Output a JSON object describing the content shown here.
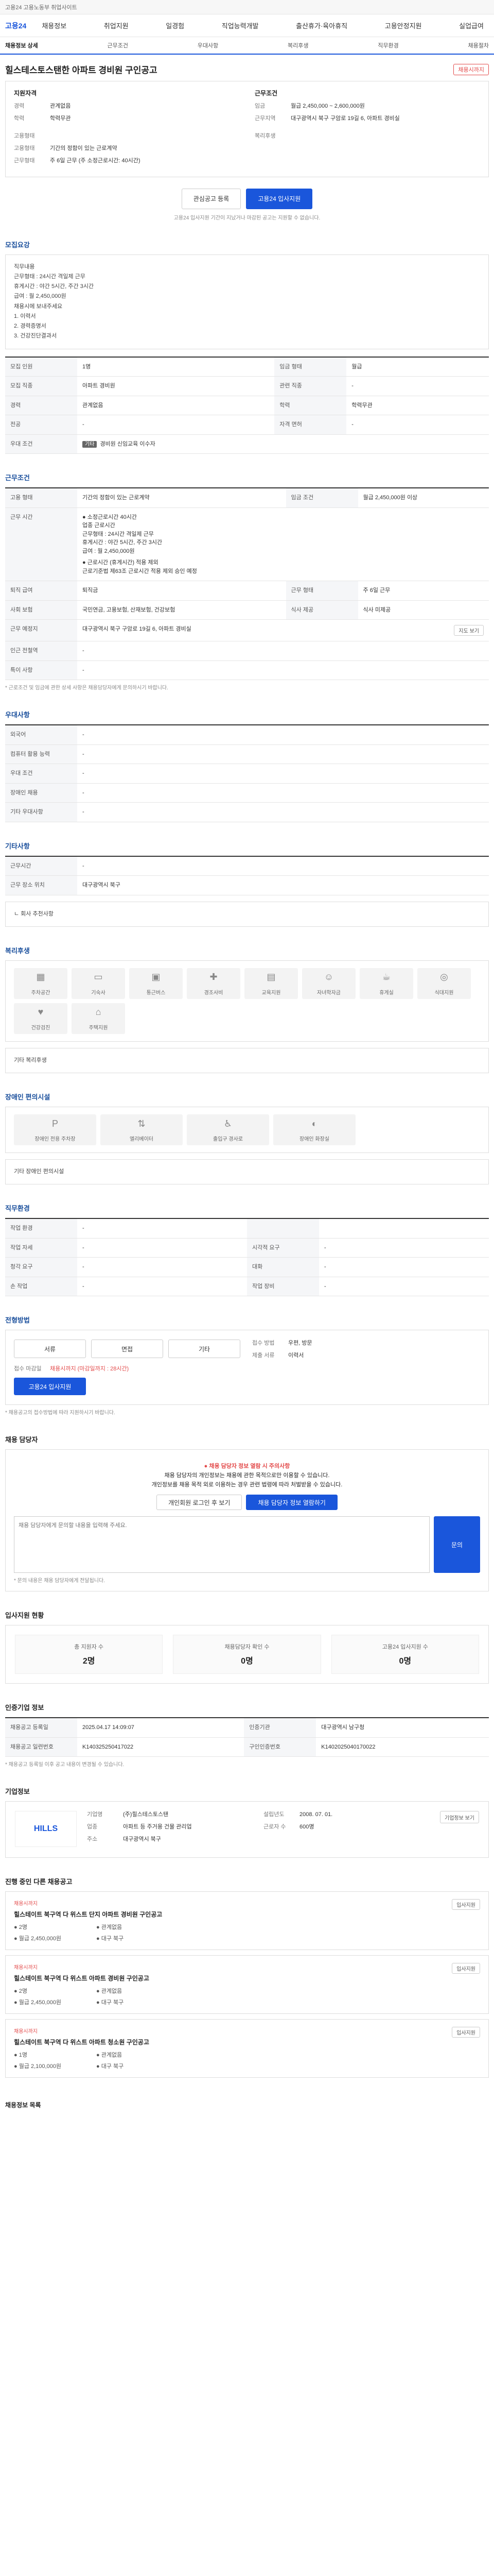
{
  "topbar": {
    "notice": "고용24 고용노동부 취업사이트"
  },
  "gnb": {
    "logo": "고용24",
    "items": [
      "채용정보",
      "취업지원",
      "일경험",
      "직업능력개발",
      "출산휴가·육아휴직",
      "고용안정지원",
      "실업급여"
    ]
  },
  "subnav": [
    "채용정보 상세",
    "근무조건",
    "우대사항",
    "복리후생",
    "직무환경",
    "채용절차"
  ],
  "job": {
    "title": "힐스테스토스탠한 아파트 경비원 구인공고",
    "status": "채용시까지"
  },
  "summary": {
    "career_heading": "지원자격",
    "career_label": "경력",
    "career": "관계없음",
    "edu_label": "학력",
    "edu": "학력무관",
    "cond_heading": "고용형태",
    "employ_label": "고용형태",
    "employ": "기간의 정함이 있는 근로계약",
    "worktime_label": "근무형태",
    "worktime": "주 6일 근무 (주 소정근로시간: 40시간)",
    "terms_heading": "근무조건",
    "salary_label": "임금",
    "salary": "월급 2,450,000 ~ 2,600,000원",
    "location_label": "근무지역",
    "location": "대구광역시 북구 구암로 19길 6, 아파트 경비실",
    "benefit_label": "복리후생"
  },
  "actions": {
    "scrap": "관심공고 등록",
    "apply": "고용24 입사지원",
    "note": "고용24 입사지원 기간이 지났거나 마감된 공고는 지원할 수 없습니다."
  },
  "recruit": {
    "title": "모집요강",
    "desc": [
      "직무내용",
      "근무형태 : 24시간 격일제 근무",
      "휴게시간 : 야간 5시간, 주간 3시간",
      "급여 : 월 2,450,000원",
      "",
      "채용시에 보내주세요",
      "1. 이력서",
      "2. 경력증명서",
      "3. 건강진단결과서"
    ],
    "rows": [
      {
        "k": "모집 인원",
        "v": "1명",
        "k2": "임금 형태",
        "v2": "월급"
      },
      {
        "k": "모집 직종",
        "v": "아파트 경비원",
        "k2": "관련 직종",
        "v2": "-"
      },
      {
        "k": "경력",
        "v": "관계없음",
        "k2": "학력",
        "v2": "학력무관"
      },
      {
        "k": "전공",
        "v": "-",
        "k2": "자격 면허",
        "v2": "-"
      },
      {
        "k": "우대 조건",
        "chip": "기타",
        "v": "경비원 신임교육 이수자"
      }
    ]
  },
  "conditions": {
    "title": "근무조건",
    "map_btn": "지도 보기",
    "rows": [
      {
        "k": "고용 형태",
        "v": "기간의 정함이 있는 근로계약",
        "k2": "임금 조건",
        "v2": "월급 2,450,000원 이상"
      },
      {
        "k": "근무 시간"
      },
      {
        "k": "퇴직 급여",
        "v": "퇴직금",
        "k2": "근무 형태",
        "v2": "주 6일 근무"
      },
      {
        "k": "사회 보험",
        "v": "국민연금, 고용보험, 산재보험, 건강보험",
        "k2": "식사 제공",
        "v2": "식사 미제공"
      },
      {
        "k": "근무 예정지",
        "v": "대구광역시 북구 구암로 19길 6, 아파트 경비실"
      },
      {
        "k": "인근 전철역",
        "v": "-"
      },
      {
        "k": "특이 사항",
        "v": "-"
      }
    ],
    "pay": [
      "● 소정근로시간 40시간",
      "업종 근로시간",
      "근무형태 : 24시간 격일제 근무",
      "휴게시간 : 야간 5시간, 주간 3시간",
      "급여 : 월 2,450,000원",
      "● 근로시간 (휴게시간) 적용 제외",
      "근로기준법 제63조 근로시간 적용 제외 승인 예정"
    ],
    "note": "* 근로조건 및 임금에 관한 상세 사항은 채용담당자에게 문의하시기 바랍니다."
  },
  "qualification": {
    "title": "우대사항",
    "rows": [
      {
        "k": "외국어",
        "v": "-"
      },
      {
        "k": "컴퓨터 활용 능력",
        "v": "-"
      },
      {
        "k": "우대 조건",
        "v": "-"
      },
      {
        "k": "장애인 채용",
        "v": "-"
      },
      {
        "k": "기타 우대사항",
        "v": "-"
      }
    ]
  },
  "other": {
    "title": "기타사항",
    "rows": [
      {
        "k": "근무시간",
        "v": "-"
      },
      {
        "k": "근무 장소 위치",
        "v": "대구광역시 북구"
      }
    ],
    "extra": "ㄴ 회사 추천사항"
  },
  "benefits": {
    "title": "복리후생",
    "items": [
      "주차공간",
      "기숙사",
      "통근버스",
      "경조사비",
      "교육지원",
      "자녀학자금",
      "휴게실",
      "식대지원",
      "건강검진",
      "주택지원"
    ],
    "extra": "기타 복리후생"
  },
  "disability": {
    "title": "장애인 편의시설",
    "items": [
      "장애인 전용 주차장",
      "엘리베이터",
      "출입구 경사로",
      "장애인 화장실"
    ],
    "extra": "기타 장애인 편의시설"
  },
  "environment": {
    "title": "직무환경",
    "rows": [
      {
        "k": "작업 환경",
        "v": "-",
        "k2": "",
        "v2": ""
      },
      {
        "k": "작업 자세",
        "v": "-",
        "k2": "시각적 요구",
        "v2": "-"
      },
      {
        "k": "청각 요구",
        "v": "-",
        "k2": "대화",
        "v2": "-"
      },
      {
        "k": "손 작업",
        "v": "-",
        "k2": "작업 장비",
        "v2": "-"
      }
    ]
  },
  "apply": {
    "title": "전형방법",
    "methods": [
      "서류",
      "면접",
      "기타"
    ],
    "deadline_label": "접수 마감일",
    "deadline": "채용시까지 (마감일까지 : 28시간)",
    "apply_btn": "고용24 입사지원",
    "method_label": "접수 방법",
    "method": "우편, 방문",
    "docs_label": "제출 서류",
    "docs": "이력서",
    "note": "* 채용공고의 접수방법에 따라 지원하시기 바랍니다."
  },
  "contact": {
    "title": "채용 담당자",
    "alert": "● 채용 담당자 정보 열람 시 주의사항",
    "lines": [
      "채용 담당자의 개인정보는 채용에 관한 목적으로만 이용할 수 있습니다.",
      "개인정보를 채용 목적 외로 이용하는 경우 관련 법령에 따라 처벌받을 수 있습니다."
    ],
    "login_btn": "개인회원 로그인 후 보기",
    "view_btn": "채용 담당자 정보 열람하기",
    "qa_placeholder": "채용 담당자에게 문의할 내용을 입력해 주세요.",
    "qa_btn": "문의",
    "note": "* 문의 내용은 채용 담당자에게 전달됩니다."
  },
  "stats": {
    "title": "입사지원 현황",
    "items": [
      {
        "label": "총 지원자 수",
        "value": "2명"
      },
      {
        "label": "채용담당자 확인 수",
        "value": "0명"
      },
      {
        "label": "고용24 입사지원 수",
        "value": "0명"
      }
    ]
  },
  "info": {
    "title": "인증기업 정보",
    "rows": [
      {
        "k": "채용공고 등록일",
        "v": "2025.04.17 14:09:07",
        "k2": "인증기관",
        "v2": "대구광역시 남구청"
      },
      {
        "k": "채용공고 일련번호",
        "v": "K140325250417022",
        "k2": "구인인증번호",
        "v2": "K1402025040170022"
      }
    ],
    "note": "* 채용공고 등록일 이후 공고 내용이 변경될 수 있습니다."
  },
  "company": {
    "title": "기업정보",
    "logo_text": "HILLS",
    "name_label": "기업명",
    "name": "(주)힐스테스토스탠",
    "industry_label": "업종",
    "industry": "아파트 등 주거용 건물 관리업",
    "address_label": "주소",
    "address": "대구광역시 북구",
    "founded_label": "설립년도",
    "founded": "2008. 07. 01.",
    "employees_label": "근로자 수",
    "employees": "600명",
    "btn": "기업정보 보기"
  },
  "other_jobs": {
    "title": "진행 중인 다른 채용공고",
    "btn": "입사지원",
    "items": [
      {
        "tag": "채용시까지",
        "name": "힐스테이트 북구역 다 위스트 단지 아파트 경비원 구인공고",
        "m1": "● 2명",
        "m2": "● 관계없음",
        "m3": "● 월급 2,450,000원",
        "m4": "● 대구 북구"
      },
      {
        "tag": "채용시까지",
        "name": "힐스테이트 북구역 다 위스트 아파트 경비원 구인공고",
        "m1": "● 2명",
        "m2": "● 관계없음",
        "m3": "● 월급 2,450,000원",
        "m4": "● 대구 북구"
      },
      {
        "tag": "채용시까지",
        "name": "힐스테이트 북구역 다 위스트 아파트 청소원 구인공고",
        "m1": "● 1명",
        "m2": "● 관계없음",
        "m3": "● 월급 2,100,000원",
        "m4": "● 대구 북구"
      }
    ]
  },
  "footer": {
    "label": "채용정보 목록"
  }
}
